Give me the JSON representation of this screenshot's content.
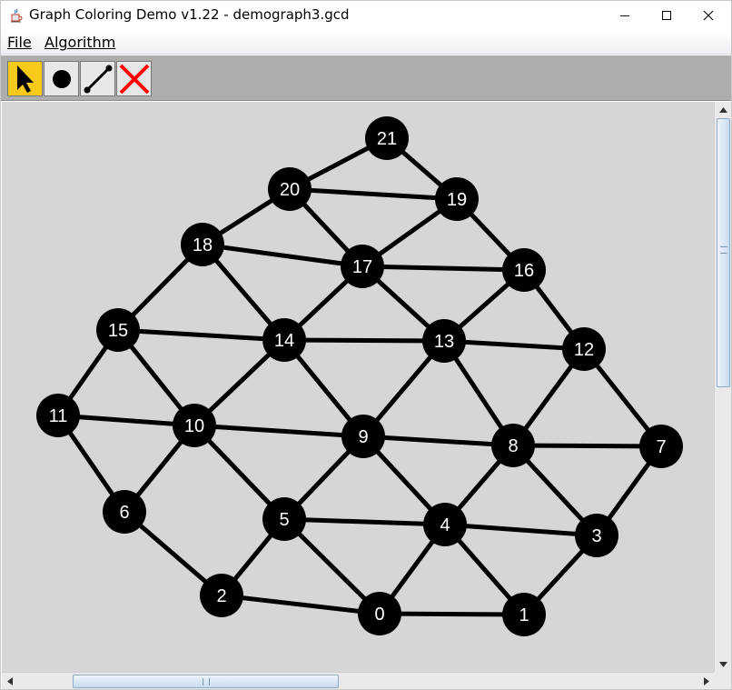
{
  "window": {
    "title": "Graph Coloring Demo v1.22 - demograph3.gcd",
    "icons": {
      "app": "java-cup-icon",
      "minimize": "minimize-icon",
      "maximize": "maximize-icon",
      "close": "close-icon"
    }
  },
  "menu": {
    "file_label": "File",
    "algorithm_label": "Algorithm"
  },
  "toolbar": {
    "tools": [
      {
        "name": "select-tool",
        "icon": "arrow-pointer-icon",
        "active": true
      },
      {
        "name": "add-node-tool",
        "icon": "filled-circle-icon",
        "active": false
      },
      {
        "name": "add-edge-tool",
        "icon": "line-segment-icon",
        "active": false
      },
      {
        "name": "delete-tool",
        "icon": "red-x-icon",
        "active": false
      }
    ],
    "active_color": "#f7c918",
    "delete_color": "#ff0000"
  },
  "canvas": {
    "background": "#d6d6d6",
    "node_color": "#000000",
    "node_label_color": "#ffffff",
    "edge_color": "#000000"
  },
  "graph": {
    "nodes": [
      {
        "id": 0,
        "label": "0"
      },
      {
        "id": 1,
        "label": "1"
      },
      {
        "id": 2,
        "label": "2"
      },
      {
        "id": 3,
        "label": "3"
      },
      {
        "id": 4,
        "label": "4"
      },
      {
        "id": 5,
        "label": "5"
      },
      {
        "id": 6,
        "label": "6"
      },
      {
        "id": 7,
        "label": "7"
      },
      {
        "id": 8,
        "label": "8"
      },
      {
        "id": 9,
        "label": "9"
      },
      {
        "id": 10,
        "label": "10"
      },
      {
        "id": 11,
        "label": "11"
      },
      {
        "id": 12,
        "label": "12"
      },
      {
        "id": 13,
        "label": "13"
      },
      {
        "id": 14,
        "label": "14"
      },
      {
        "id": 15,
        "label": "15"
      },
      {
        "id": 16,
        "label": "16"
      },
      {
        "id": 17,
        "label": "17"
      },
      {
        "id": 18,
        "label": "18"
      },
      {
        "id": 19,
        "label": "19"
      },
      {
        "id": 20,
        "label": "20"
      },
      {
        "id": 21,
        "label": "21"
      }
    ],
    "edges": [
      [
        21,
        20
      ],
      [
        21,
        19
      ],
      [
        20,
        19
      ],
      [
        20,
        18
      ],
      [
        20,
        17
      ],
      [
        19,
        17
      ],
      [
        19,
        16
      ],
      [
        18,
        17
      ],
      [
        18,
        15
      ],
      [
        18,
        14
      ],
      [
        17,
        16
      ],
      [
        17,
        14
      ],
      [
        17,
        13
      ],
      [
        16,
        13
      ],
      [
        16,
        12
      ],
      [
        15,
        14
      ],
      [
        15,
        11
      ],
      [
        15,
        10
      ],
      [
        14,
        13
      ],
      [
        14,
        10
      ],
      [
        14,
        9
      ],
      [
        13,
        12
      ],
      [
        13,
        9
      ],
      [
        13,
        8
      ],
      [
        12,
        8
      ],
      [
        12,
        7
      ],
      [
        11,
        10
      ],
      [
        11,
        6
      ],
      [
        10,
        9
      ],
      [
        10,
        6
      ],
      [
        10,
        5
      ],
      [
        9,
        8
      ],
      [
        9,
        5
      ],
      [
        9,
        4
      ],
      [
        8,
        7
      ],
      [
        8,
        4
      ],
      [
        8,
        3
      ],
      [
        7,
        3
      ],
      [
        6,
        2
      ],
      [
        5,
        4
      ],
      [
        5,
        2
      ],
      [
        5,
        0
      ],
      [
        4,
        3
      ],
      [
        4,
        1
      ],
      [
        4,
        0
      ],
      [
        3,
        1
      ],
      [
        2,
        0
      ],
      [
        0,
        1
      ]
    ]
  }
}
